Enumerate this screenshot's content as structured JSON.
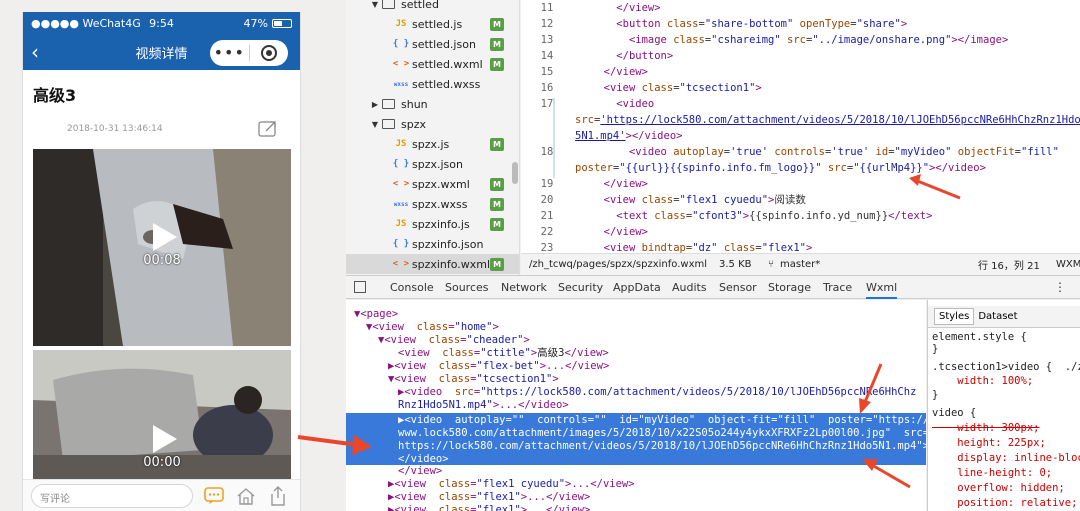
{
  "colors": {
    "nav_blue": "#1b62ae",
    "selection_blue": "#3879d9",
    "arrow_red": "#e8472b",
    "badge_green": "#5b9e4a"
  },
  "phone": {
    "status": {
      "carrier": "●●●●● WeChat4G",
      "time": "9:54",
      "battery": "47%"
    },
    "nav": {
      "back_icon": "chevron-left-icon",
      "title": "视频详情",
      "menu": "•••"
    },
    "title": "高级3",
    "date": "2018-10-31 13:46:14",
    "videos": [
      {
        "duration": "00:08"
      },
      {
        "duration": "00:00"
      }
    ],
    "comment_placeholder": "写评论"
  },
  "tree": [
    {
      "name": "settled",
      "type": "folder",
      "open": true
    },
    {
      "name": "settled.js",
      "icon": "JS",
      "badge": "M"
    },
    {
      "name": "settled.json",
      "icon": "{ }",
      "badge": "M"
    },
    {
      "name": "settled.wxml",
      "icon": "< >",
      "badge": "M"
    },
    {
      "name": "settled.wxss",
      "icon": "wxss",
      "badge": ""
    },
    {
      "name": "shun",
      "type": "folder",
      "open": false
    },
    {
      "name": "spzx",
      "type": "folder",
      "open": true
    },
    {
      "name": "spzx.js",
      "icon": "JS",
      "badge": "M"
    },
    {
      "name": "spzx.json",
      "icon": "{ }",
      "badge": ""
    },
    {
      "name": "spzx.wxml",
      "icon": "< >",
      "badge": "M"
    },
    {
      "name": "spzx.wxss",
      "icon": "wxss",
      "badge": "M"
    },
    {
      "name": "spzxinfo.js",
      "icon": "JS",
      "badge": "M"
    },
    {
      "name": "spzxinfo.json",
      "icon": "{ }",
      "badge": ""
    },
    {
      "name": "spzxinfo.wxml",
      "icon": "< >",
      "badge": "M"
    }
  ],
  "editor": {
    "line_numbers": [
      "11",
      "12",
      "13",
      "14",
      "15",
      "16",
      "17",
      "",
      "",
      "18",
      "",
      "19",
      "20",
      "21",
      "22",
      "23"
    ],
    "status": {
      "path": "/zh_tcwq/pages/spzx/spzxinfo.wxml",
      "size": "3.5 KB",
      "branch": "master*",
      "position": "行 16，列 21",
      "lang": "WXM"
    }
  },
  "devtools": {
    "tabs": [
      "Console",
      "Sources",
      "Network",
      "Security",
      "AppData",
      "Audits",
      "Sensor",
      "Storage",
      "Trace",
      "Wxml"
    ],
    "active_tab": "Wxml",
    "styles_tabs": [
      "Styles",
      "Dataset"
    ],
    "styles": [
      "element.style {",
      "}",
      ".tcsection1>video {  ./zh",
      "    width: 100%;",
      "}",
      "video {",
      "    width: 300px;",
      "    height: 225px;",
      "    display: inline-block",
      "    line-height: 0;",
      "    overflow: hidden;",
      "    position: relative;"
    ]
  }
}
